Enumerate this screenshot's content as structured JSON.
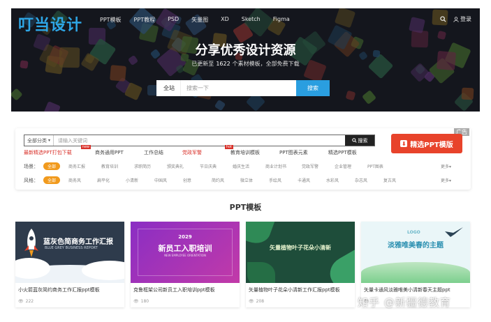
{
  "brand": {
    "logo": "叮当设计"
  },
  "nav": {
    "items": [
      "PPT模板",
      "PPT教程",
      "PSD",
      "矢量图",
      "XD",
      "Sketch",
      "Figma"
    ],
    "login": "登录"
  },
  "hero": {
    "title": "分享优秀设计资源",
    "sub_prefix": "已更新至",
    "count": "1622",
    "sub_suffix": "个素材模板，全部免费下载",
    "scope": "全站",
    "placeholder": "搜索一下",
    "search_btn": "搜索"
  },
  "filter": {
    "category": "全部分类",
    "keyword_placeholder": "请输入关键词",
    "search_btn": "搜索",
    "promo": "精选PPT模版",
    "ad": "广告",
    "quick_links": [
      {
        "label": "最新精选PPT打包下载",
        "hot": true,
        "badge": "new"
      },
      {
        "label": "商务通用PPT",
        "hot": false,
        "badge": ""
      },
      {
        "label": "工作总结",
        "hot": false,
        "badge": ""
      },
      {
        "label": "党政军警",
        "hot": true,
        "badge": "hot"
      },
      {
        "label": "教育培训模板",
        "hot": false,
        "badge": ""
      },
      {
        "label": "PPT图表元素",
        "hot": false,
        "badge": ""
      },
      {
        "label": "精选PPT模板",
        "hot": false,
        "badge": ""
      }
    ],
    "scene": {
      "label": "场景：",
      "all": "全部",
      "items": [
        "商务汇报",
        "教育培训",
        "求职简历",
        "颁奖典礼",
        "节日庆典",
        "婚庆生活",
        "商业计划书",
        "党政军警",
        "企业管理",
        "PPT图表"
      ],
      "more": "更多▾"
    },
    "style": {
      "label": "风格：",
      "all": "全部",
      "items": [
        "商务风",
        "扁平化",
        "小清新",
        "中国风",
        "创意",
        "简约风",
        "微立体",
        "手绘风",
        "卡通风",
        "水彩风",
        "杂志风",
        "复古风"
      ],
      "more": "更多▾"
    }
  },
  "section": {
    "title": "PPT模板"
  },
  "cards": [
    {
      "title": "小火箭蓝灰简约商务工作汇报ppt模板",
      "views": "222",
      "thumb_title": "蓝灰色简商务工作汇报",
      "thumb_sub": "BLUE GREY BUSINESS REPORT"
    },
    {
      "title": "克鲁框架公司新员工入职培训ppt模板",
      "views": "180",
      "thumb_title": "新员工入职培训",
      "thumb_year": "2029",
      "thumb_sub": "NEW EMPLOYEE ORIENTATION"
    },
    {
      "title": "矢量植物叶子花朵小清新工作汇报ppt模板",
      "views": "208",
      "thumb_title": "矢量植物叶子花朵小清新"
    },
    {
      "title": "矢量卡通风淡雅唯美小清新春天主题ppt",
      "views": "",
      "thumb_title": "淡雅唯美春的主题",
      "thumb_logo": "LOGO"
    }
  ],
  "watermark": "知乎 @新疆德教育",
  "colors": {
    "accent": "#2a9ee0",
    "promo": "#e8432b",
    "tag": "#f19a1d",
    "hot": "#d9312a"
  }
}
